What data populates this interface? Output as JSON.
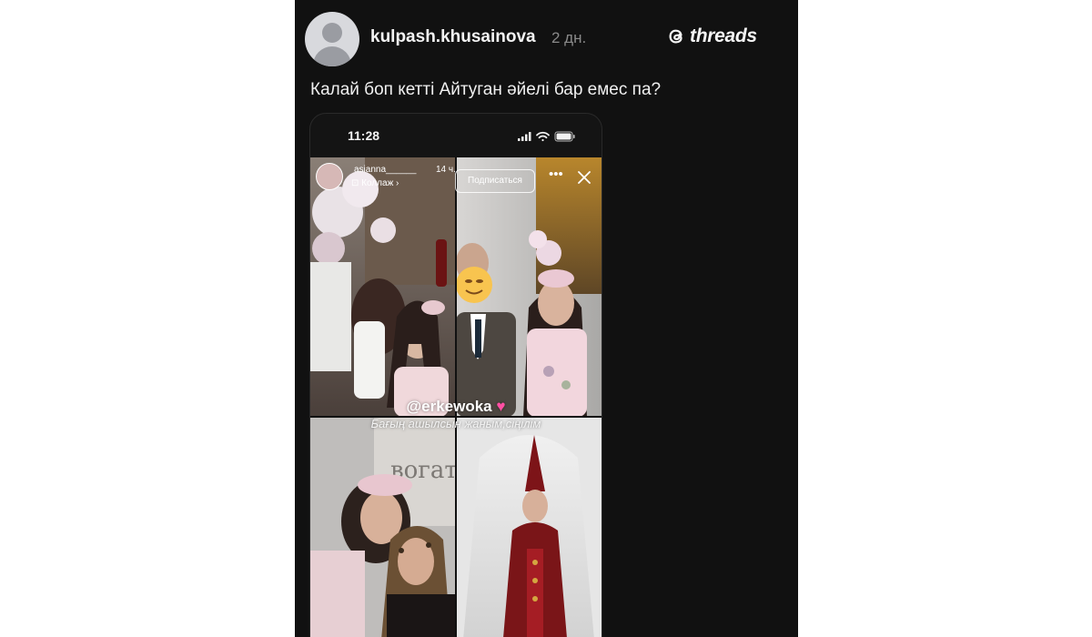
{
  "post": {
    "username": "kulpash.khusainova",
    "time_ago": "2 дн.",
    "brand": "threads",
    "caption": "Калай боп кетті Айтуган әйелі бар емес па?"
  },
  "screenshot": {
    "status_time": "11:28",
    "story": {
      "username": "asianna______",
      "age": "14 ч.",
      "subtitle": "Коллаж",
      "follow_label": "Подписаться",
      "more_icon": "more-horizontal-icon",
      "close_icon": "close-icon",
      "mention": "@erkewoka",
      "caption": "Бағың ашылсын жаным,сіңілім"
    }
  },
  "colors": {
    "post_bg": "#111111",
    "page_bg": "#ffffff",
    "text": "#f0f0f0",
    "muted": "#8a8a8a"
  }
}
